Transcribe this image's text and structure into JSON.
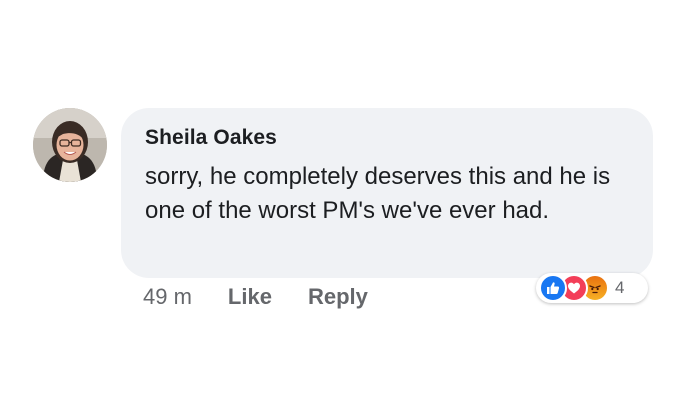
{
  "comment": {
    "author": "Sheila Oakes",
    "text": "sorry, he completely deserves this and he is one of the worst PM's we've ever had.",
    "timestamp": "49 m",
    "like_label": "Like",
    "reply_label": "Reply",
    "reactions": {
      "types": [
        "like-icon",
        "love-icon",
        "angry-icon"
      ],
      "count": "4"
    }
  },
  "colors": {
    "bubble_background": "#f0f2f5",
    "meta_text": "#65676b",
    "like": "#1877f2",
    "love": "#f33e58",
    "angry": "#e9710f"
  }
}
